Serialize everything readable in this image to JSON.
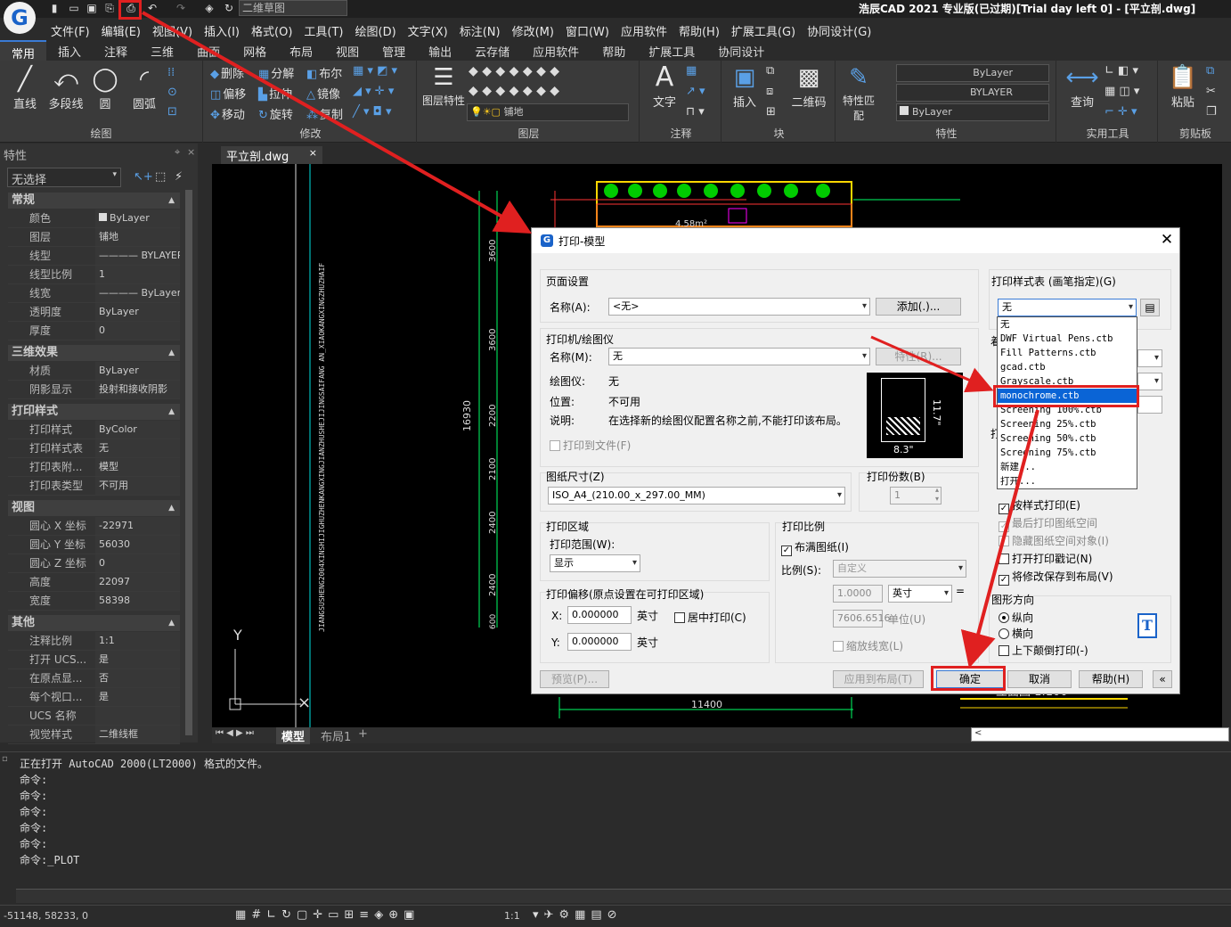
{
  "app": {
    "logo": "G",
    "title": "浩辰CAD 2021 专业版(已过期)[Trial day left 0] - [平立剖.dwg]",
    "workspace": "二维草图"
  },
  "menu": [
    "文件(F)",
    "编辑(E)",
    "视图(V)",
    "插入(I)",
    "格式(O)",
    "工具(T)",
    "绘图(D)",
    "文字(X)",
    "标注(N)",
    "修改(M)",
    "窗口(W)",
    "应用软件",
    "帮助(H)",
    "扩展工具(G)",
    "协同设计(G)"
  ],
  "ribbon_tabs": [
    "常用",
    "插入",
    "注释",
    "三维",
    "曲面",
    "网格",
    "布局",
    "视图",
    "管理",
    "输出",
    "云存储",
    "应用软件",
    "帮助",
    "扩展工具",
    "协同设计"
  ],
  "ribbon": {
    "draw": {
      "title": "绘图",
      "line": "直线",
      "pline": "多段线",
      "circle": "圆",
      "arc": "圆弧"
    },
    "modify": {
      "title": "修改",
      "erase": "删除",
      "explode": "分解",
      "boolean": "布尔",
      "offset": "偏移",
      "stretch": "拉伸",
      "mirror": "镜像",
      "move": "移动",
      "rotate": "旋转",
      "copy": "复制"
    },
    "layer": {
      "title": "图层",
      "props": "图层特性",
      "current": "铺地"
    },
    "annotation": {
      "title": "注释",
      "text": "文字"
    },
    "block": {
      "title": "块",
      "insert": "插入",
      "qrcode": "二维码"
    },
    "properties": {
      "title": "特性",
      "match": "特性匹配",
      "color": "ByLayer",
      "linetype": "BYLAYER",
      "lineweight": "ByLayer"
    },
    "utilities": {
      "title": "实用工具",
      "query": "查询"
    },
    "clipboard": {
      "title": "剪贴板",
      "paste": "粘贴"
    }
  },
  "props_panel": {
    "header": "特性",
    "selection": "无选择",
    "sections": {
      "general": {
        "title": "常规",
        "rows": [
          [
            "颜色",
            "ByLayer"
          ],
          [
            "图层",
            "铺地"
          ],
          [
            "线型",
            "———— BYLAYER"
          ],
          [
            "线型比例",
            "1"
          ],
          [
            "线宽",
            "———— ByLayer"
          ],
          [
            "透明度",
            "ByLayer"
          ],
          [
            "厚度",
            "0"
          ]
        ]
      },
      "three_d": {
        "title": "三维效果",
        "rows": [
          [
            "材质",
            "ByLayer"
          ],
          [
            "阴影显示",
            "投射和接收阴影"
          ]
        ]
      },
      "plot_style": {
        "title": "打印样式",
        "rows": [
          [
            "打印样式",
            "ByColor"
          ],
          [
            "打印样式表",
            "无"
          ],
          [
            "打印表附...",
            "模型"
          ],
          [
            "打印表类型",
            "不可用"
          ]
        ]
      },
      "view": {
        "title": "视图",
        "rows": [
          [
            "圆心 X 坐标",
            "-22971"
          ],
          [
            "圆心 Y 坐标",
            "56030"
          ],
          [
            "圆心 Z 坐标",
            "0"
          ],
          [
            "高度",
            "22097"
          ],
          [
            "宽度",
            "58398"
          ]
        ]
      },
      "misc": {
        "title": "其他",
        "rows": [
          [
            "注释比例",
            "1:1"
          ],
          [
            "打开 UCS...",
            "是"
          ],
          [
            "在原点显...",
            "否"
          ],
          [
            "每个视口...",
            "是"
          ],
          [
            "UCS 名称",
            ""
          ],
          [
            "视觉样式",
            "二维线框"
          ]
        ]
      }
    }
  },
  "doc_tab": "平立剖.dwg",
  "drawing": {
    "vertical_text": "JIANGSUSHENG2004XINSHIJIGHUZHENKANGXINGJIANZHUSHEJIJINGSAIFANG AN_XIAOKANGXINGZHUZHAIF",
    "dims": [
      "3600",
      "3600",
      "2200",
      "2100",
      "2400",
      "2400",
      "600"
    ],
    "total_dim": "16930",
    "bottom_dim": "11400",
    "room_label": "4.58m²",
    "ucs_y": "Y",
    "elevation_note": "立面图 1:100"
  },
  "layout_tabs": [
    "模型",
    "布局1",
    "+"
  ],
  "command": {
    "lines": [
      "正在打开 AutoCAD 2000(LT2000) 格式的文件。",
      "命令:",
      "命令:",
      "命令:",
      "命令:",
      "命令:",
      "命令:_PLOT"
    ]
  },
  "status": {
    "coords": "-51148, 58233, 0",
    "scale": "1:1"
  },
  "dialog": {
    "title": "打印-模型",
    "page_setup": {
      "title": "页面设置",
      "name_label": "名称(A):",
      "name_value": "<无>",
      "add_button": "添加(.)..."
    },
    "printer": {
      "title": "打印机/绘图仪",
      "name_label": "名称(M):",
      "name_value": "无",
      "props_button": "特性(R)...",
      "plotter_label": "绘图仪:",
      "plotter_value": "无",
      "location_label": "位置:",
      "location_value": "不可用",
      "desc_label": "说明:",
      "desc_value": "在选择新的绘图仪配置名称之前,不能打印该布局。",
      "print_to_file": "打印到文件(F)",
      "preview_w": "8.3\"",
      "preview_h": "11.7\""
    },
    "paper_size": {
      "title": "图纸尺寸(Z)",
      "value": "ISO_A4_(210.00_x_297.00_MM)"
    },
    "copies": {
      "title": "打印份数(B)",
      "value": "1"
    },
    "area": {
      "title": "打印区域",
      "range_label": "打印范围(W):",
      "range_value": "显示"
    },
    "offset": {
      "title": "打印偏移(原点设置在可打印区域)",
      "x_label": "X:",
      "x_value": "0.000000",
      "y_label": "Y:",
      "y_value": "0.000000",
      "unit": "英寸",
      "center": "居中打印(C)"
    },
    "scale": {
      "title": "打印比例",
      "fit": "布满图纸(I)",
      "scale_label": "比例(S):",
      "scale_value": "自定义",
      "inch_value": "1.0000",
      "inch_unit": "英寸",
      "units_value": "7606.6516",
      "units_label": "单位(U)",
      "lineweights": "缩放线宽(L)"
    },
    "style_table": {
      "title": "打印样式表 (画笔指定)(G)",
      "value": "无"
    },
    "options": {
      "plot_with_styles": "按样式打印(E)",
      "paperspace_last": "最后打印图纸空间",
      "hide_paperspace": "隐藏图纸空间对象(I)",
      "stamp": "打开打印戳记(N)",
      "save_changes": "将修改保存到布局(V)",
      "partial_a": "着",
      "partial_b": "打"
    },
    "orientation": {
      "title": "图形方向",
      "portrait": "纵向",
      "landscape": "横向",
      "upside_down": "上下颠倒打印(-)"
    },
    "buttons": {
      "preview": "预览(P)...",
      "apply": "应用到布局(T)",
      "ok": "确定",
      "cancel": "取消",
      "help": "帮助(H)",
      "expand": "«"
    },
    "ctb_list": [
      "无",
      "DWF Virtual Pens.ctb",
      "Fill Patterns.ctb",
      "gcad.ctb",
      "Grayscale.ctb",
      "monochrome.ctb",
      "Screening 100%.ctb",
      "Screening 25%.ctb",
      "Screening 50%.ctb",
      "Screening 75%.ctb",
      "新建...",
      "打开..."
    ]
  }
}
